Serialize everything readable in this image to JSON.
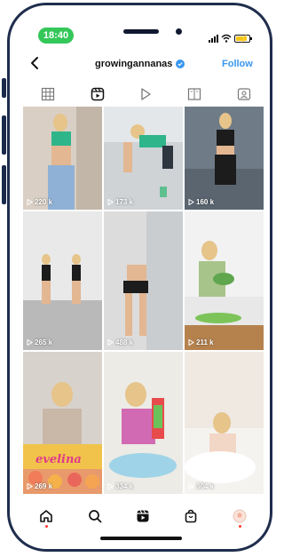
{
  "status_bar": {
    "time": "18:40"
  },
  "header": {
    "username": "growingannanas",
    "follow_label": "Follow"
  },
  "tabs": [
    {
      "name": "grid-icon",
      "active": false
    },
    {
      "name": "reels-icon",
      "active": true
    },
    {
      "name": "play-icon",
      "active": false
    },
    {
      "name": "guide-icon",
      "active": false
    },
    {
      "name": "tagged-icon",
      "active": false
    }
  ],
  "grid": {
    "tiles": [
      {
        "count": "220 k",
        "overlay": ""
      },
      {
        "count": "173 k",
        "overlay": ""
      },
      {
        "count": "160 k",
        "overlay": ""
      },
      {
        "count": "265 k",
        "overlay": ""
      },
      {
        "count": "488 k",
        "overlay": ""
      },
      {
        "count": "211 k",
        "overlay": ""
      },
      {
        "count": "269 k",
        "overlay": ""
      },
      {
        "count": "334 k",
        "overlay": ""
      },
      {
        "count": "304 k",
        "overlay": ""
      }
    ],
    "sign_text": "evelina"
  },
  "bottom_nav": [
    {
      "name": "home-icon"
    },
    {
      "name": "search-icon"
    },
    {
      "name": "reels-nav-icon"
    },
    {
      "name": "shop-icon"
    },
    {
      "name": "profile-avatar"
    }
  ],
  "colors": {
    "follow": "#3897f0",
    "status_pill": "#34c759",
    "frame": "#1f2d4d"
  }
}
